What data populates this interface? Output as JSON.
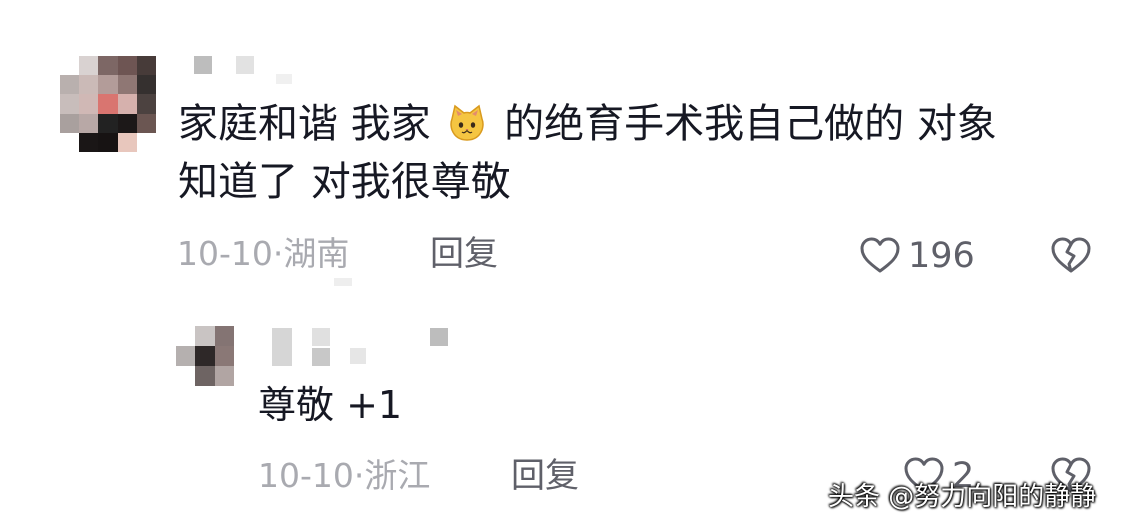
{
  "comments": [
    {
      "text_line1_a": "家庭和谐 我家",
      "emoji": "cat-face-icon",
      "text_line1_b": "的绝育手术我自己做的 对象",
      "text_line2": "知道了 对我很尊敬",
      "date": "10-10",
      "separator": "·",
      "location": "湖南",
      "reply_label": "回复",
      "like_count": "196"
    },
    {
      "text": "尊敬 +1",
      "date": "10-10",
      "separator": "·",
      "location": "浙江",
      "reply_label": "回复",
      "like_count": "2"
    }
  ],
  "watermark": "头条 @努力向阳的静静",
  "colors": {
    "text": "#161823",
    "meta": "#a9aab0",
    "action": "#5f6069"
  }
}
